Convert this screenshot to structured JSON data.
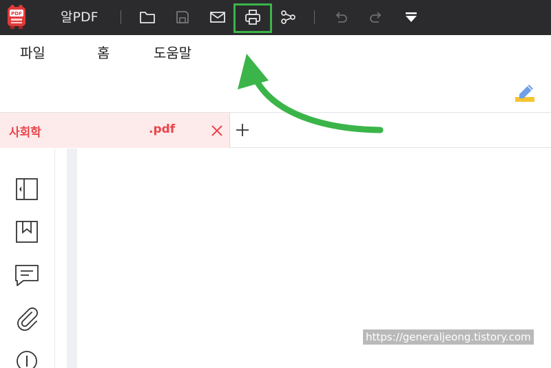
{
  "app": {
    "title": "알PDF"
  },
  "toolbar": {
    "icons": [
      "open-folder-icon",
      "save-icon",
      "mail-icon",
      "print-icon",
      "share-icon",
      "undo-icon",
      "redo-icon",
      "more-dropdown-icon"
    ],
    "highlight_color": "#3bb54a"
  },
  "menu": {
    "file": "파일",
    "home": "홈",
    "help": "도움말"
  },
  "tab": {
    "name": "사회학",
    "ext": ".pdf",
    "accent": "#e8454a"
  },
  "sidebar": {
    "icons": [
      "thumbnail-panel-icon",
      "bookmark-icon",
      "comment-icon",
      "attachment-icon",
      "info-icon"
    ]
  },
  "watermark": {
    "text": "https://generaljeong.tistory.com"
  }
}
